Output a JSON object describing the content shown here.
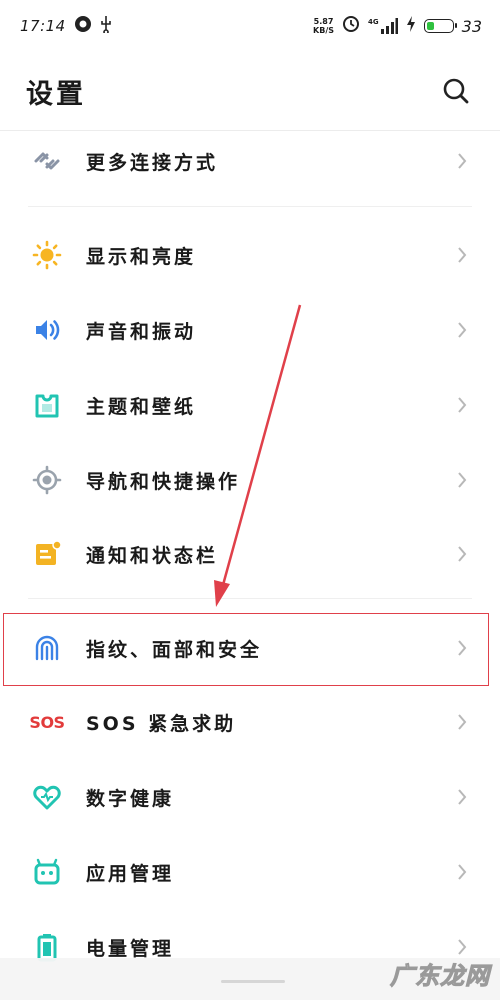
{
  "status_bar": {
    "time": "17:14",
    "net_speed_value": "5.87",
    "net_speed_unit": "KB/S",
    "network_type": "4G",
    "battery_percent": "33",
    "battery_level": 0.33,
    "battery_color": "#2fc13f"
  },
  "header": {
    "title": "设置",
    "search_icon": "search-icon"
  },
  "settings": [
    {
      "label": "更多连接方式",
      "icon": "connection-icon",
      "color": "#8a94a6"
    },
    {
      "label": "显示和亮度",
      "icon": "sun-icon",
      "color": "#f7b523"
    },
    {
      "label": "声音和振动",
      "icon": "speaker-icon",
      "color": "#3b82e6"
    },
    {
      "label": "主题和壁纸",
      "icon": "theme-icon",
      "color": "#21c4b2"
    },
    {
      "label": "导航和快捷操作",
      "icon": "target-icon",
      "color": "#9aa3ad"
    },
    {
      "label": "通知和状态栏",
      "icon": "notification-icon",
      "color": "#f3b323"
    },
    {
      "label": "指纹、面部和安全",
      "icon": "fingerprint-icon",
      "color": "#3b82e6"
    },
    {
      "label": "SOS 紧急求助",
      "icon_text": "SOS",
      "icon": "sos-icon",
      "color": "#e23b3b"
    },
    {
      "label": "数字健康",
      "icon": "heart-icon",
      "color": "#21c4b2"
    },
    {
      "label": "应用管理",
      "icon": "android-icon",
      "color": "#21c4b2"
    },
    {
      "label": "电量管理",
      "icon": "battery-icon",
      "color": "#21c4b2"
    }
  ],
  "watermark": "广东龙网",
  "highlight_color": "#e0404a"
}
